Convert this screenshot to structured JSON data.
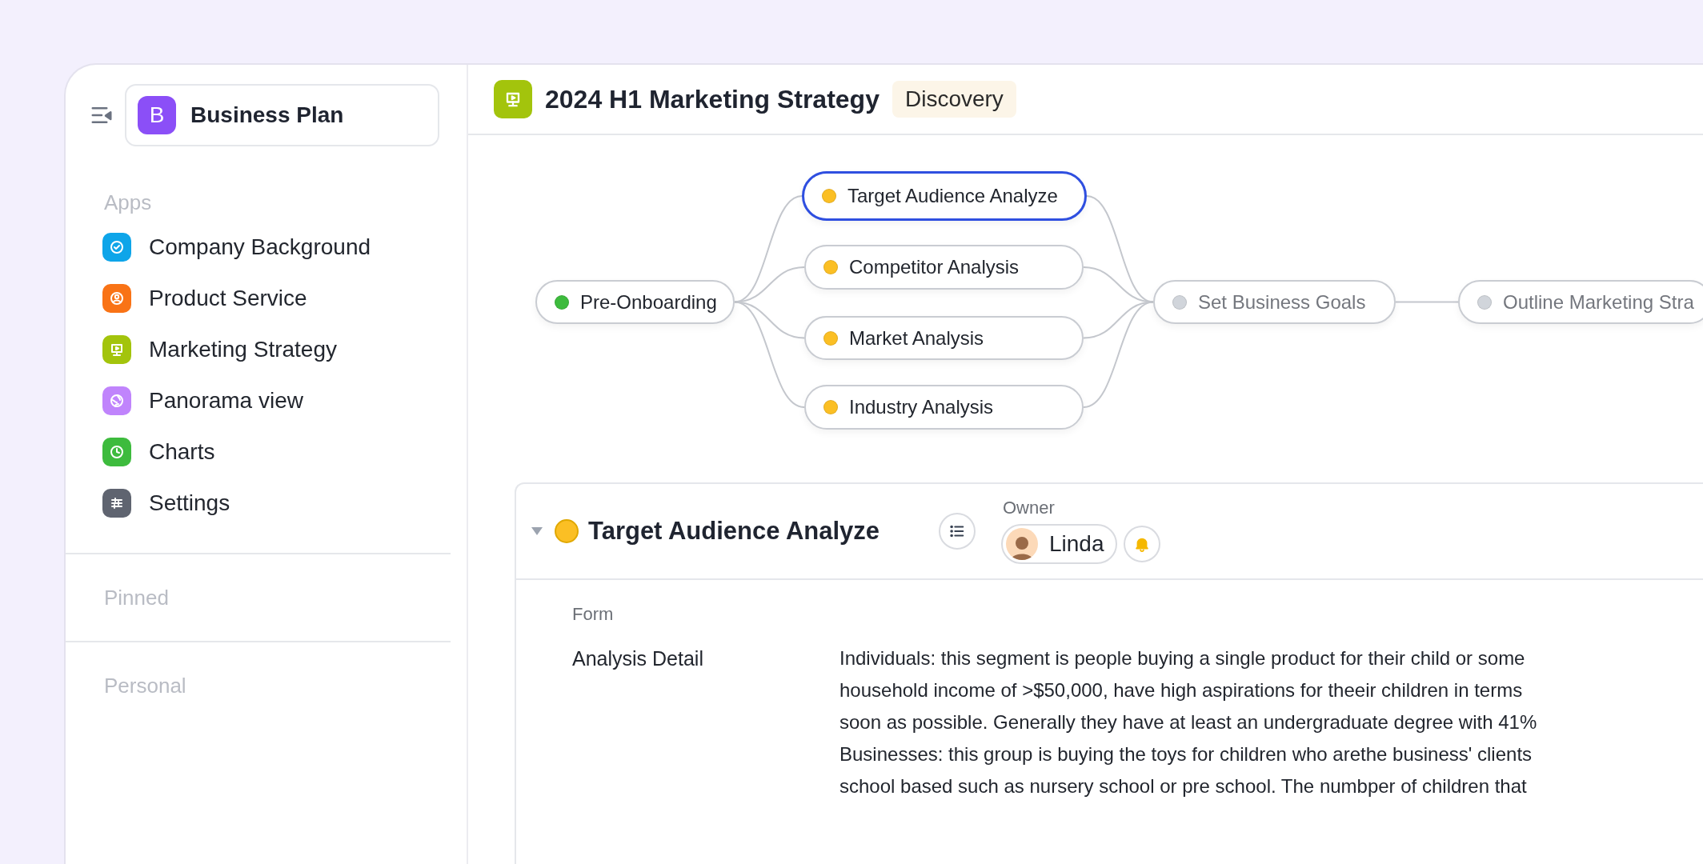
{
  "sidebar": {
    "workspace": {
      "letter": "B",
      "name": "Business Plan"
    },
    "sections": [
      {
        "label": "Apps",
        "items": [
          {
            "label": "Company Background",
            "color": "#0ea5e9"
          },
          {
            "label": "Product Service",
            "color": "#f97316"
          },
          {
            "label": "Marketing Strategy",
            "color": "#a3c40c"
          },
          {
            "label": "Panorama view",
            "color": "#c084fc"
          },
          {
            "label": "Charts",
            "color": "#3dbb3d"
          },
          {
            "label": "Settings",
            "color": "#5f6470"
          }
        ]
      },
      {
        "label": "Pinned"
      },
      {
        "label": "Personal"
      }
    ]
  },
  "header": {
    "title": "2024 H1 Marketing Strategy",
    "badge": "Discovery"
  },
  "flow": {
    "nodes": [
      {
        "label": "Pre-Onboarding",
        "color": "#3dbb3d",
        "selected": false,
        "disabled": false
      },
      {
        "label": "Target Audience Analyze",
        "color": "#fbbf24",
        "selected": true,
        "disabled": false
      },
      {
        "label": "Competitor Analysis",
        "color": "#fbbf24",
        "selected": false,
        "disabled": false
      },
      {
        "label": "Market Analysis",
        "color": "#fbbf24",
        "selected": false,
        "disabled": false
      },
      {
        "label": "Industry Analysis",
        "color": "#fbbf24",
        "selected": false,
        "disabled": false
      },
      {
        "label": "Set Business Goals",
        "color": "#d1d5db",
        "selected": false,
        "disabled": true
      },
      {
        "label": "Outline Marketing Stra",
        "color": "#d1d5db",
        "selected": false,
        "disabled": true
      }
    ]
  },
  "task": {
    "title": "Target Audience Analyze",
    "color": "#fbbf24",
    "expanded": true,
    "owner_label": "Owner",
    "owner": "Linda",
    "form_label": "Form",
    "fields": [
      {
        "label": "Analysis Detail",
        "lines": [
          "Individuals: this segment is people buying a single product for their child or some",
          "household income of >$50,000, have high aspirations for theeir children in terms",
          "soon as possible. Generally they have at least an undergraduate degree with 41%",
          "Businesses: this group is buying the toys for children who arethe business' clients",
          "school based such as nursery school or pre school. The numbper of children that"
        ]
      }
    ]
  }
}
